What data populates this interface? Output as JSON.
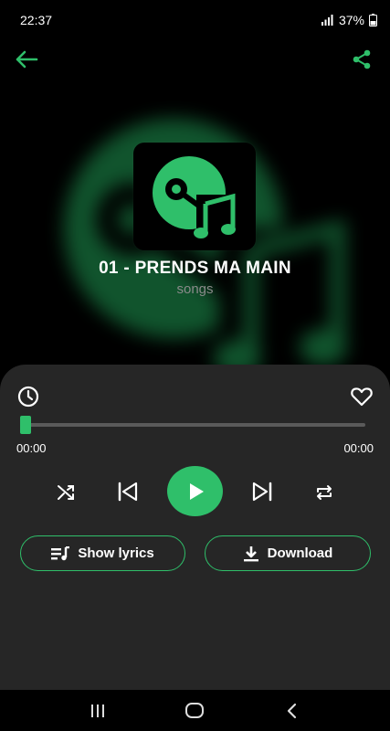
{
  "status_bar": {
    "time": "22:37",
    "battery": "37%",
    "icons": [
      "signal-icon",
      "battery-icon"
    ]
  },
  "top_bar": {
    "back_icon": "arrow-left-icon",
    "share_icon": "share-icon"
  },
  "song": {
    "title": "01 - PRENDS MA MAIN",
    "subtitle": "songs",
    "art_icon": "vinyl-music-icon"
  },
  "player": {
    "progress": 0.0,
    "time_elapsed": "00:00",
    "time_total": "00:00",
    "controls": [
      "shuffle-icon",
      "previous-icon",
      "play-icon",
      "next-icon",
      "repeat-icon"
    ],
    "show_lyrics_label": "Show lyrics",
    "download_label": "Download"
  },
  "colors": {
    "accent": "#2fbf6a",
    "panel": "#262626",
    "background": "#000000"
  },
  "nav": [
    "recent-apps-icon",
    "home-icon",
    "back-nav-icon"
  ]
}
